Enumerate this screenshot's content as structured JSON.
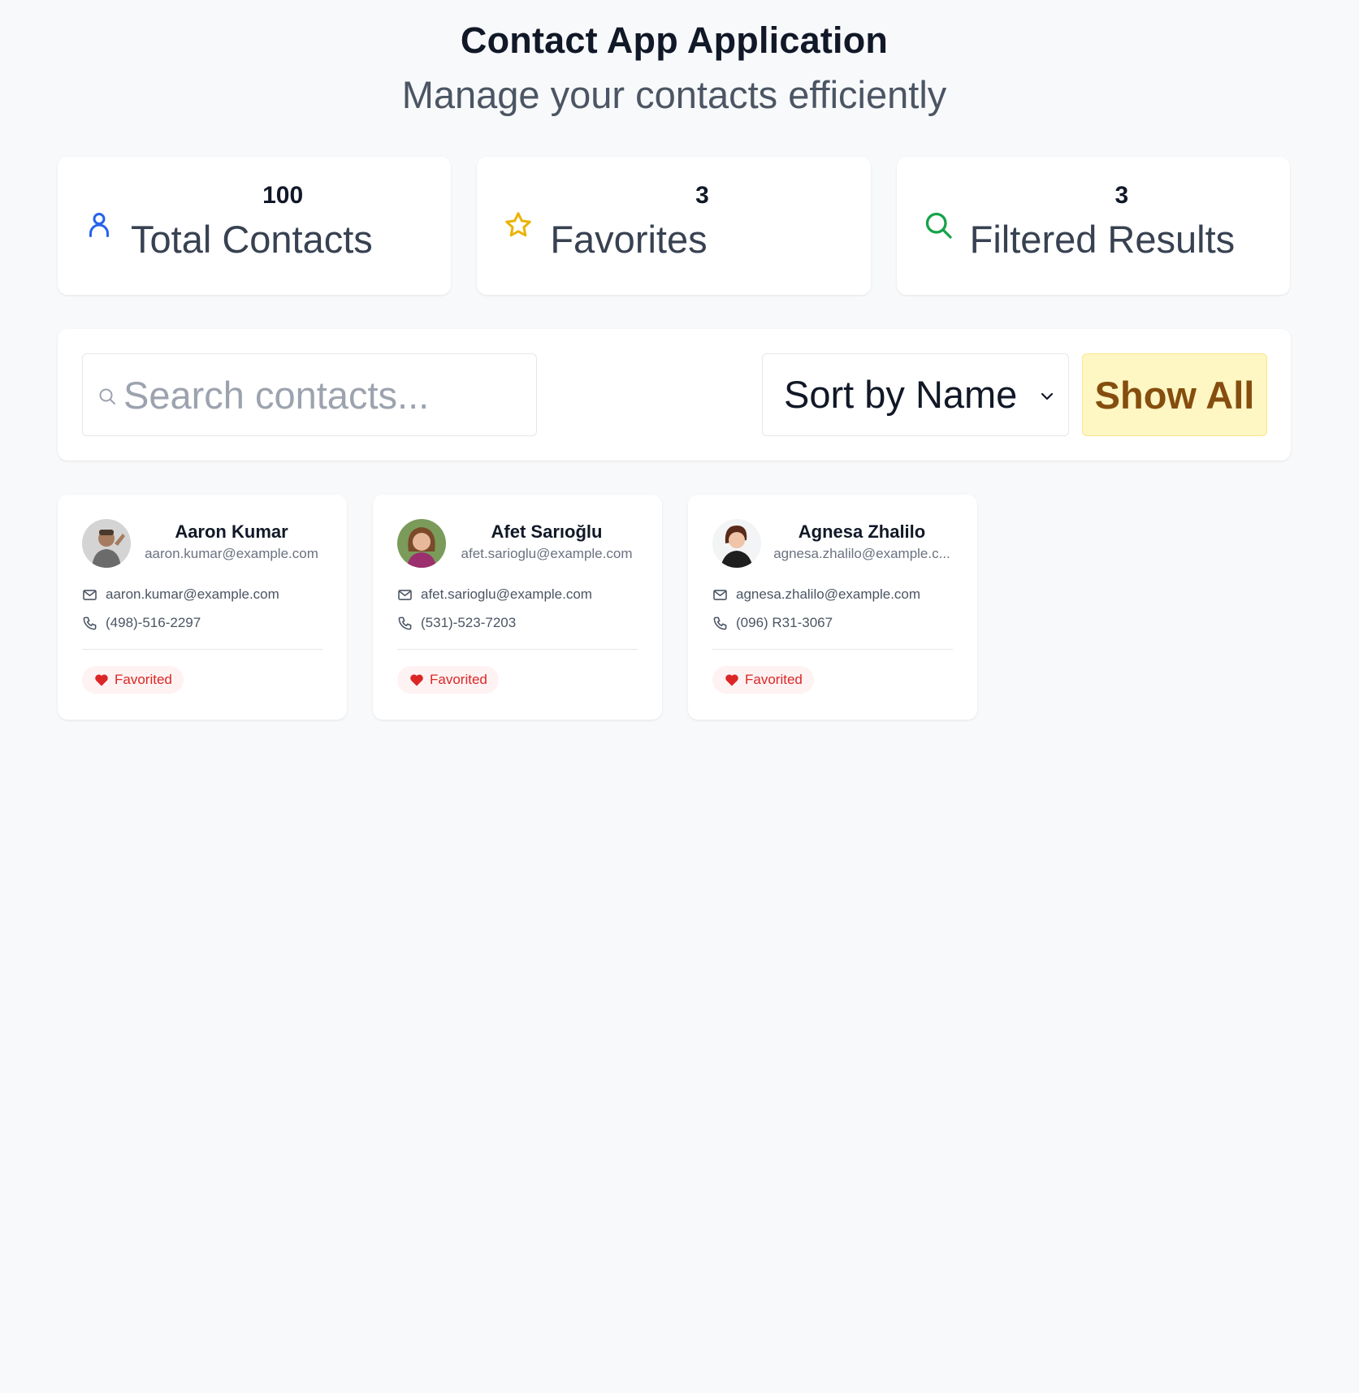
{
  "header": {
    "title": "Contact App Application",
    "subtitle": "Manage your contacts efficiently"
  },
  "stats": [
    {
      "value": "100",
      "label": "Total Contacts",
      "icon": "user-icon",
      "color": "#2563eb"
    },
    {
      "value": "3",
      "label": "Favorites",
      "icon": "star-icon",
      "color": "#eab308"
    },
    {
      "value": "3",
      "label": "Filtered Results",
      "icon": "search-icon",
      "color": "#16a34a"
    }
  ],
  "toolbar": {
    "search_placeholder": "Search contacts...",
    "search_value": "",
    "sort_selected": "Sort by Name",
    "show_all_label": "Show All"
  },
  "contacts": [
    {
      "name": "Aaron Kumar",
      "subtitle_email": "aaron.kumar@example.com",
      "email": "aaron.kumar@example.com",
      "phone": "(498)-516-2297",
      "badge": "Favorited"
    },
    {
      "name": "Afet Sarıoğlu",
      "subtitle_email": "afet.sarioglu@example.com",
      "email": "afet.sarioglu@example.com",
      "phone": "(531)-523-7203",
      "badge": "Favorited"
    },
    {
      "name": "Agnesa Zhalilo",
      "subtitle_email": "agnesa.zhalilo@example.c...",
      "email": "agnesa.zhalilo@example.com",
      "phone": "(096) R31-3067",
      "badge": "Favorited"
    }
  ],
  "colors": {
    "background": "#f8f9fb",
    "favorite_red": "#dc2626",
    "show_all_bg": "#fef6c3",
    "show_all_text": "#854d0e"
  }
}
